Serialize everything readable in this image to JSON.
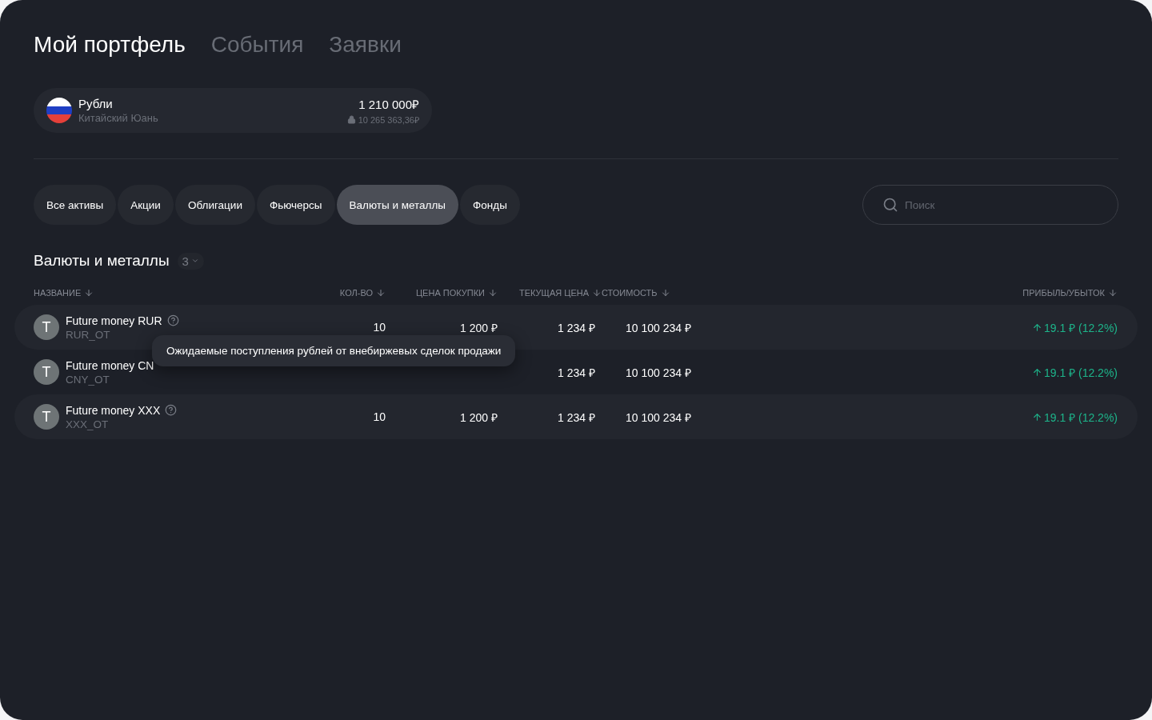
{
  "nav_tabs": [
    {
      "label": "Мой портфель",
      "selected": true
    },
    {
      "label": "События",
      "selected": false
    },
    {
      "label": "Заявки",
      "selected": false
    }
  ],
  "account": {
    "name": "Рубли",
    "subtitle": "Китайский Юань",
    "amount": "1 210 000₽",
    "blocked": "10 265 363,36₽"
  },
  "filters": [
    {
      "label": "Все активы",
      "selected": false
    },
    {
      "label": "Акции",
      "selected": false
    },
    {
      "label": "Облигации",
      "selected": false
    },
    {
      "label": "Фьючерсы",
      "selected": false
    },
    {
      "label": "Валюты и металлы",
      "selected": true
    },
    {
      "label": "Фонды",
      "selected": false
    }
  ],
  "search": {
    "placeholder": "Поиск"
  },
  "section": {
    "title": "Валюты и металлы",
    "count": "3"
  },
  "table": {
    "columns": [
      "НАЗВАНИЕ",
      "КОЛ-ВО",
      "ЦЕНА ПОКУПКИ",
      "ТЕКУЩАЯ ЦЕНА",
      "СТОИМОСТЬ",
      "ПРИБЫЛЬ/УБЫТОК"
    ],
    "rows": [
      {
        "avatar": "T",
        "name": "Future money RUR",
        "help": true,
        "ticker": "RUR_OT",
        "qty": "10",
        "buy_price": "1 200 ₽",
        "price": "1 234 ₽",
        "value": "10 100 234 ₽",
        "profit": "19.1 ₽ (12.2%)"
      },
      {
        "avatar": "T",
        "name": "Future money CN",
        "help": false,
        "ticker": "CNY_OT",
        "price": "1 234 ₽",
        "value": "10 100 234 ₽",
        "profit": "19.1 ₽ (12.2%)"
      },
      {
        "avatar": "T",
        "name": "Future money XXX",
        "help": true,
        "ticker": "XXX_OT",
        "qty": "10",
        "buy_price": "1 200 ₽",
        "price": "1 234 ₽",
        "value": "10 100 234 ₽",
        "profit": "19.1 ₽ (12.2%)"
      }
    ]
  },
  "tooltip": "Ожидаемые поступления рублей от внебиржевых сделок продажи"
}
